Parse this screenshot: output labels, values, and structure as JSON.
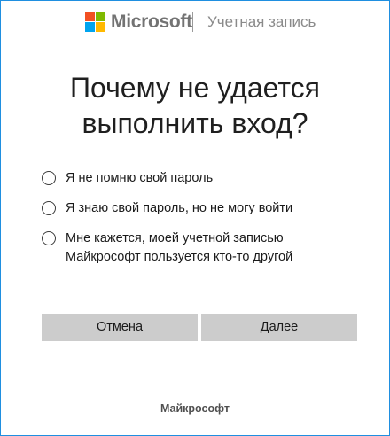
{
  "header": {
    "brand": "Microsoft",
    "logo_icon": "microsoft-logo-icon",
    "section": "Учетная запись"
  },
  "heading": {
    "line1": "Почему не удается",
    "line2": "выполнить вход?"
  },
  "options": [
    {
      "label": "Я не помню свой пароль",
      "checked": false
    },
    {
      "label": "Я знаю свой пароль, но не могу войти",
      "checked": false
    },
    {
      "label_line1": "Мне кажется, моей учетной записью",
      "label_line2": "Майкрософт пользуется кто-то другой",
      "checked": false
    }
  ],
  "buttons": {
    "cancel": "Отмена",
    "next": "Далее"
  },
  "footer": {
    "text": "Майкрософт"
  },
  "colors": {
    "window_border": "#1f8fe0",
    "logo_red": "#f25022",
    "logo_green": "#7fba00",
    "logo_blue": "#00a4ef",
    "logo_yellow": "#ffb900",
    "button_bg": "#cccccc"
  }
}
